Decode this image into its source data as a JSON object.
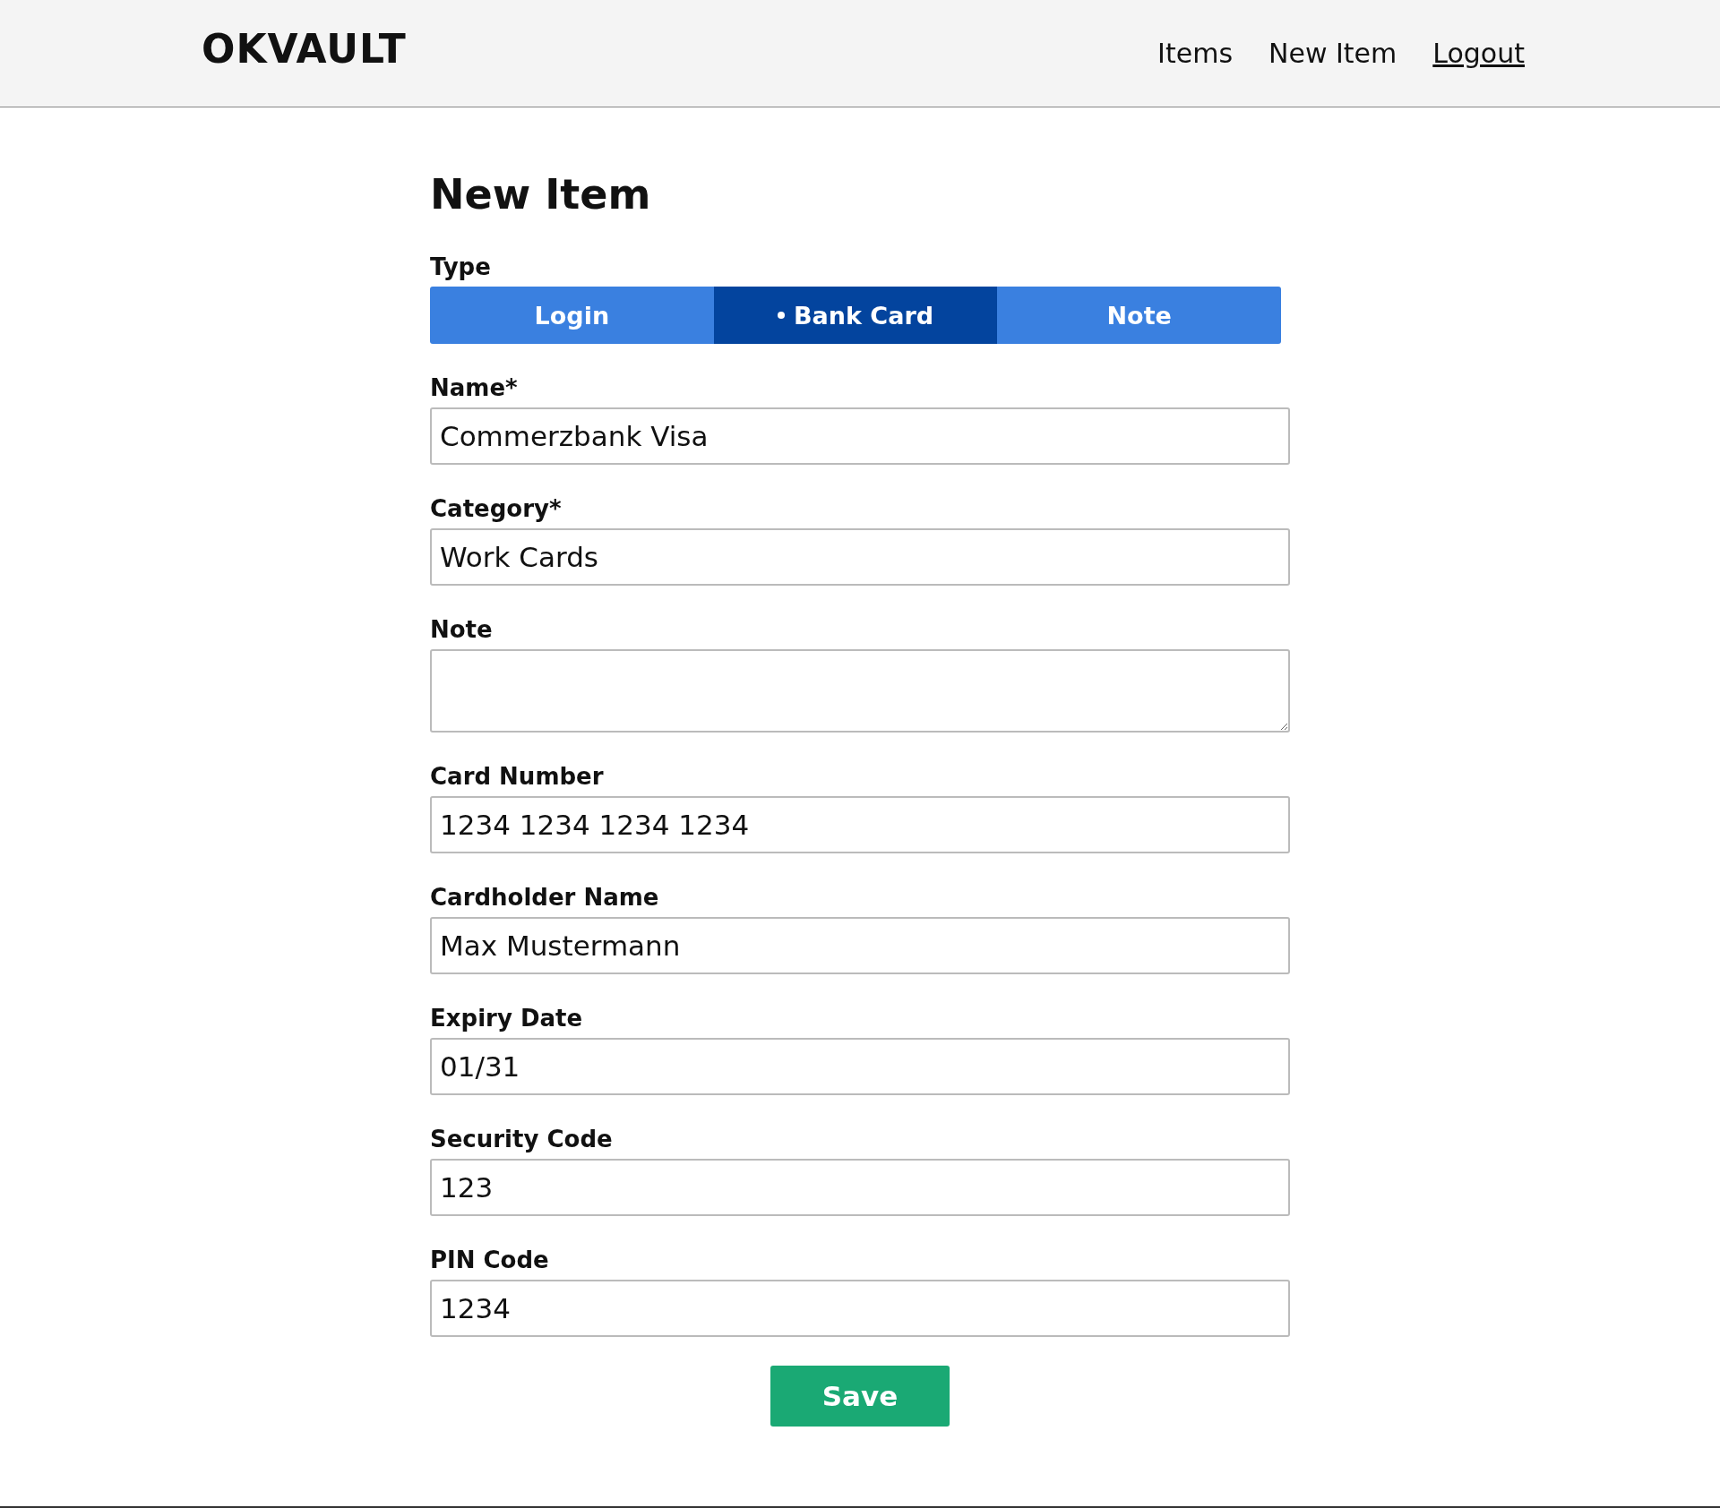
{
  "header": {
    "logo": "OKVAULT",
    "nav": [
      {
        "label": "Items",
        "kind": "plain"
      },
      {
        "label": "New Item",
        "kind": "plain"
      },
      {
        "label": "Logout",
        "kind": "underlined"
      }
    ]
  },
  "page_title": "New Item",
  "type": {
    "label": "Type",
    "tabs": [
      {
        "label": "Login",
        "selected": false
      },
      {
        "label": "Bank Card",
        "selected": true
      },
      {
        "label": "Note",
        "selected": false
      }
    ]
  },
  "fields": [
    {
      "label": "Name*",
      "value": "Commerzbank Visa",
      "kind": "input"
    },
    {
      "label": "Category*",
      "value": "Work Cards",
      "kind": "input"
    },
    {
      "label": "Note",
      "kind": "textarea"
    },
    {
      "label": "Card Number",
      "value": "1234 1234 1234 1234",
      "kind": "input"
    },
    {
      "label": "Cardholder Name",
      "value": "Max Mustermann",
      "kind": "input"
    },
    {
      "label": "Expiry Date",
      "value": "01/31",
      "kind": "input"
    },
    {
      "label": "Security Code",
      "value": "123",
      "kind": "input"
    },
    {
      "label": "PIN Code",
      "value": "1234",
      "kind": "input"
    }
  ],
  "save_button": "Save"
}
